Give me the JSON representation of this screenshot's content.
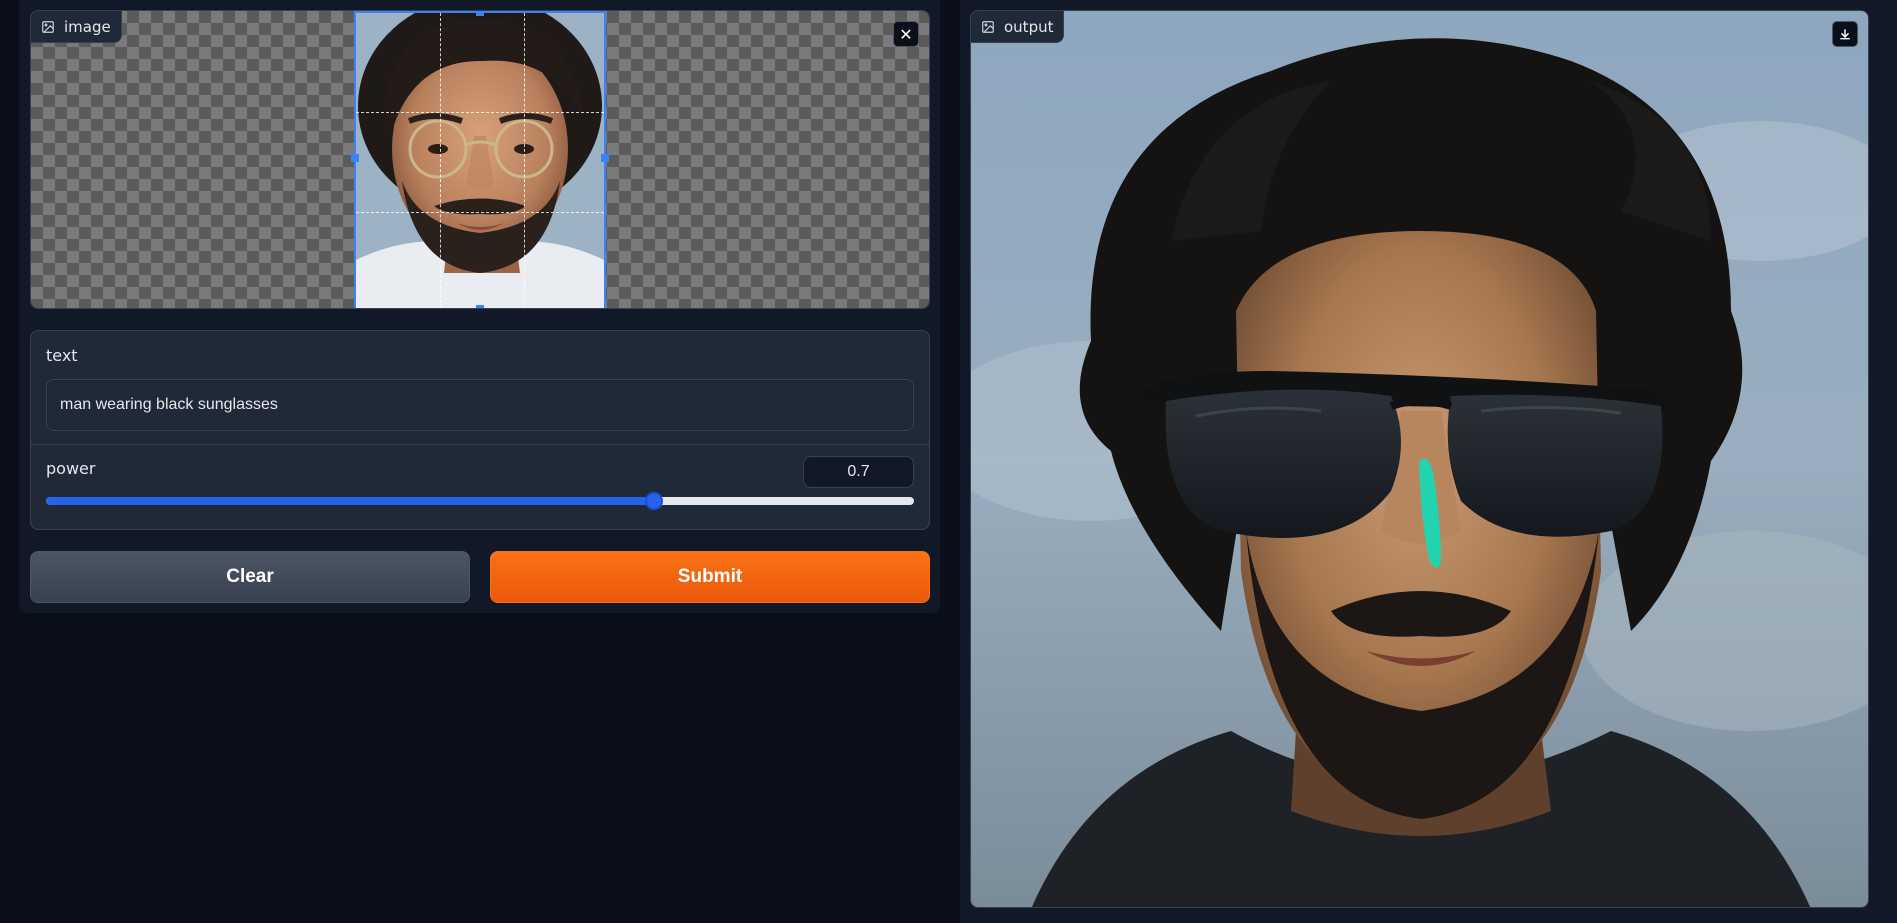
{
  "input": {
    "label": "image",
    "label_icon": "image-icon",
    "close_icon": "close-icon",
    "close_glyph": "✕"
  },
  "form": {
    "text_label": "text",
    "text_value": "man wearing black sunglasses",
    "power_label": "power",
    "power_value": "0.7",
    "power_fraction": 0.7
  },
  "buttons": {
    "clear_label": "Clear",
    "submit_label": "Submit"
  },
  "output": {
    "label": "output",
    "label_icon": "image-icon",
    "download_icon": "download-icon"
  },
  "colors": {
    "accent_blue": "#2563eb",
    "submit_orange": "#f97316",
    "background": "#0b0f19"
  }
}
